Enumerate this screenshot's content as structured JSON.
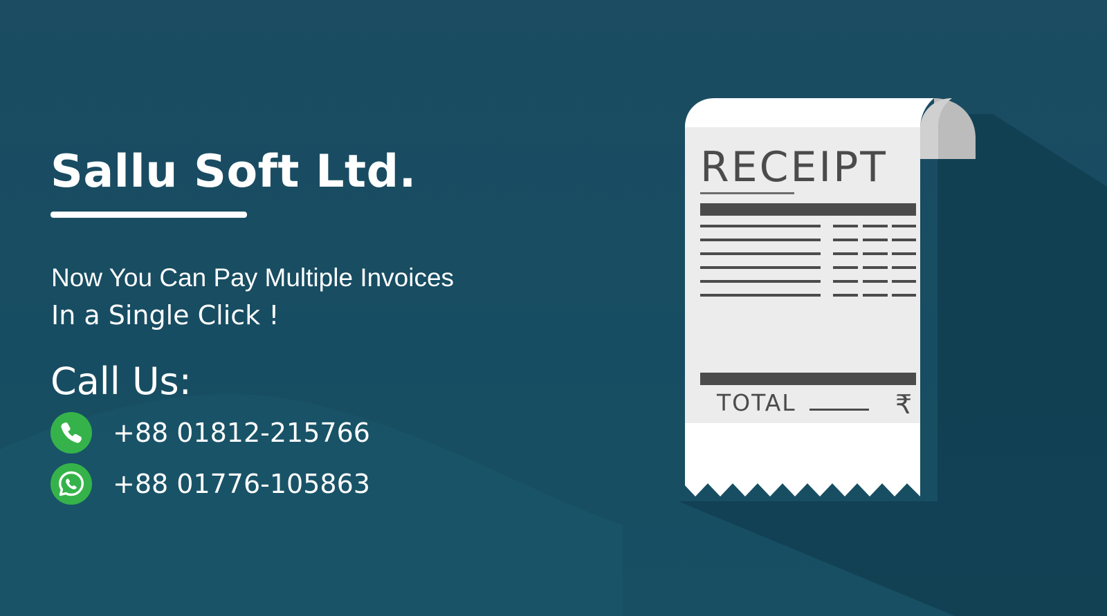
{
  "banner": {
    "company_name": "Sallu Soft Ltd.",
    "tagline_line_1": "Now You Can Pay Multiple Invoices",
    "tagline_line_2": "In a Single Click !",
    "call_heading": "Call Us:"
  },
  "contacts": [
    {
      "icon": "phone-icon",
      "number": "+88 01812-215766"
    },
    {
      "icon": "whatsapp-icon",
      "number": "+88 01776-105863"
    }
  ],
  "receipt": {
    "title": "RECEIPT",
    "total_label": "TOTAL",
    "currency_symbol": "₹"
  },
  "colors": {
    "background": "#1a4b5f",
    "text": "#ffffff",
    "icon_green": "#35b34a",
    "receipt_paper": "#ececec",
    "receipt_ink": "#4b4b4b"
  }
}
